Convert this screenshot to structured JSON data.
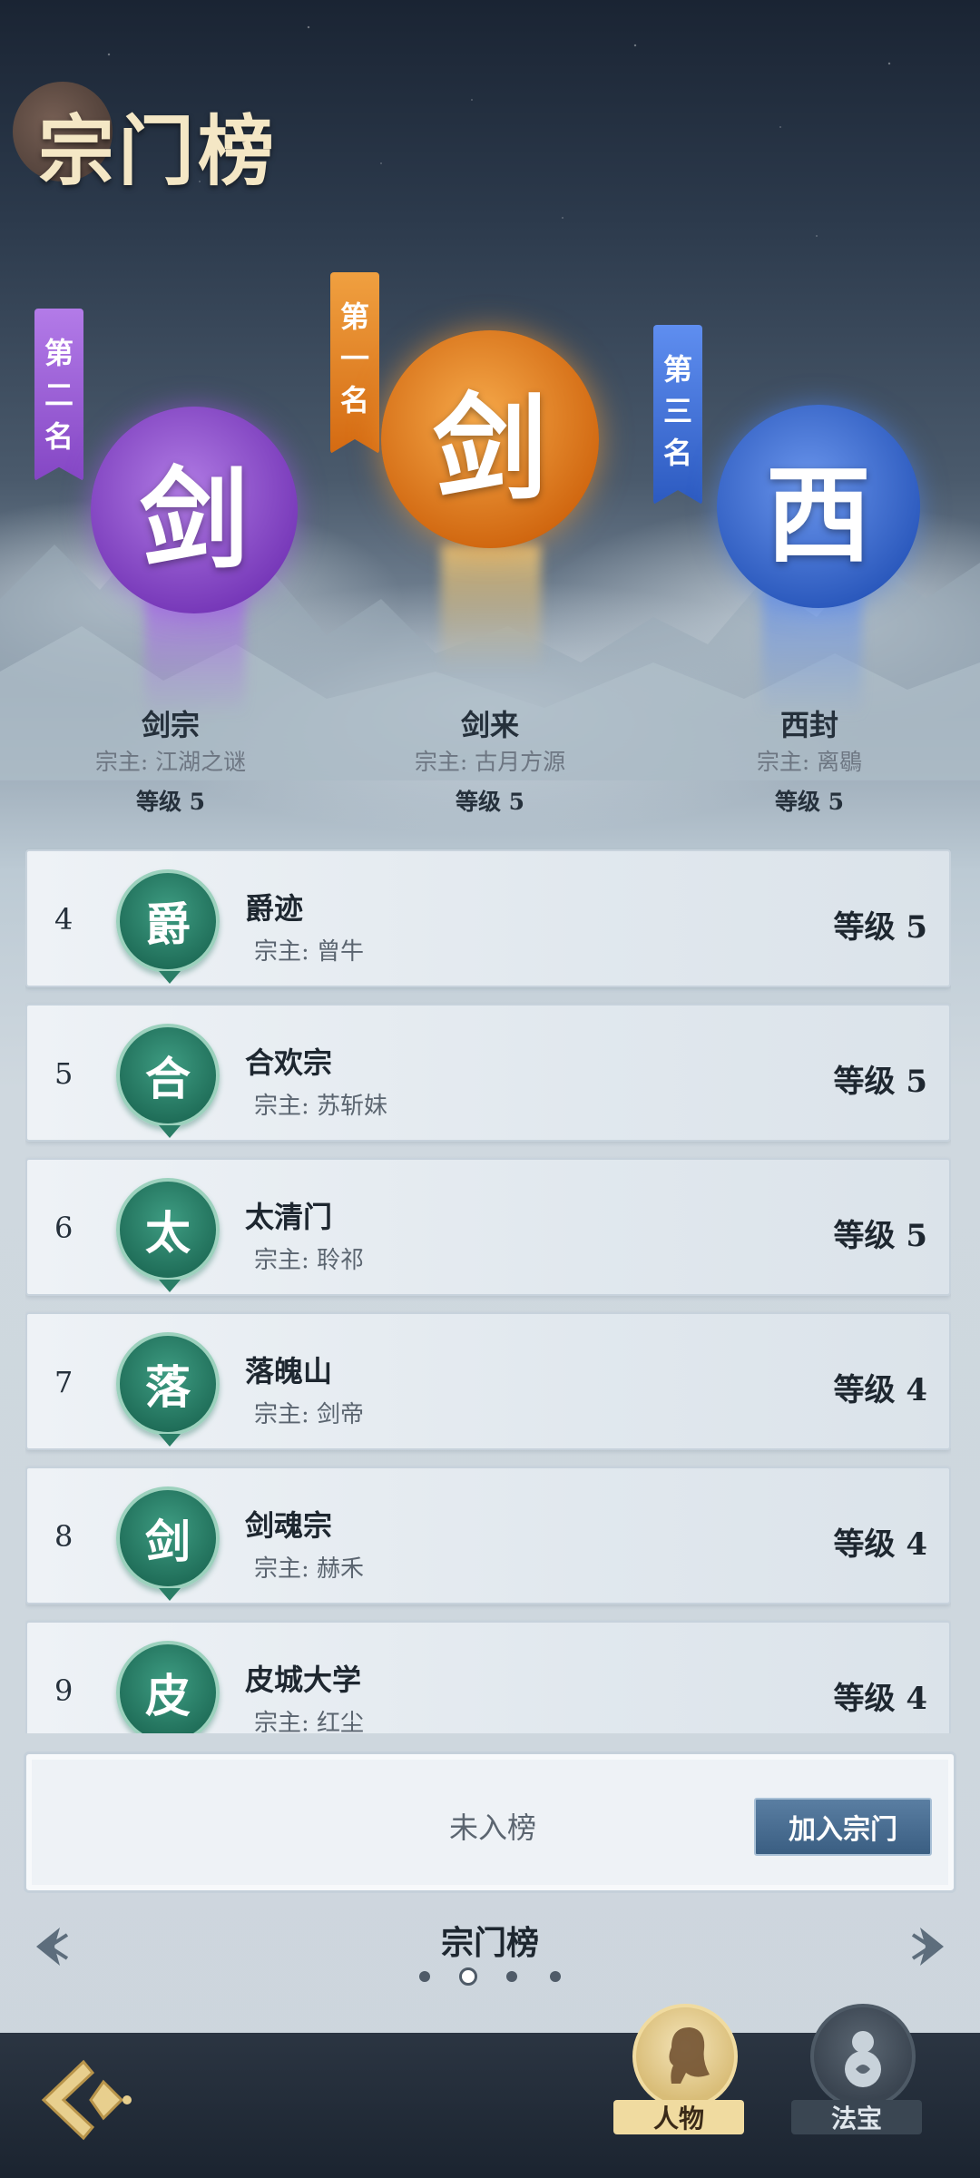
{
  "title": "宗门榜",
  "podium": [
    {
      "banner": [
        "第",
        "二",
        "名"
      ],
      "emblem": "剑",
      "name": "剑宗",
      "master": "宗主: 江湖之谜",
      "level": "等级 5",
      "color": "#8a4bd0"
    },
    {
      "banner": [
        "第",
        "一",
        "名"
      ],
      "emblem": "剑",
      "name": "剑来",
      "master": "宗主: 古月方源",
      "level": "等级 5",
      "color": "#e07a1e"
    },
    {
      "banner": [
        "第",
        "三",
        "名"
      ],
      "emblem": "西",
      "name": "西封",
      "master": "宗主: 离鶡",
      "level": "等级 5",
      "color": "#2e63c4"
    }
  ],
  "rows": [
    {
      "rank": "4",
      "emblem": "爵",
      "name": "爵迹",
      "master": "宗主: 曾牛",
      "level": "等级 5"
    },
    {
      "rank": "5",
      "emblem": "合",
      "name": "合欢宗",
      "master": "宗主: 苏斩妹",
      "level": "等级 5"
    },
    {
      "rank": "6",
      "emblem": "太",
      "name": "太清门",
      "master": "宗主: 聆祁",
      "level": "等级 5"
    },
    {
      "rank": "7",
      "emblem": "落",
      "name": "落魄山",
      "master": "宗主: 剑帝",
      "level": "等级 4"
    },
    {
      "rank": "8",
      "emblem": "剑",
      "name": "剑魂宗",
      "master": "宗主: 赫禾",
      "level": "等级 4"
    },
    {
      "rank": "9",
      "emblem": "皮",
      "name": "皮城大学",
      "master": "宗主: 红尘",
      "level": "等级 4"
    }
  ],
  "my_rank": {
    "status": "未入榜",
    "join_label": "加入宗门"
  },
  "pager": {
    "title": "宗门榜",
    "page_count": 4,
    "active_page": 2
  },
  "bottom_nav": {
    "character_label": "人物",
    "treasure_label": "法宝"
  }
}
